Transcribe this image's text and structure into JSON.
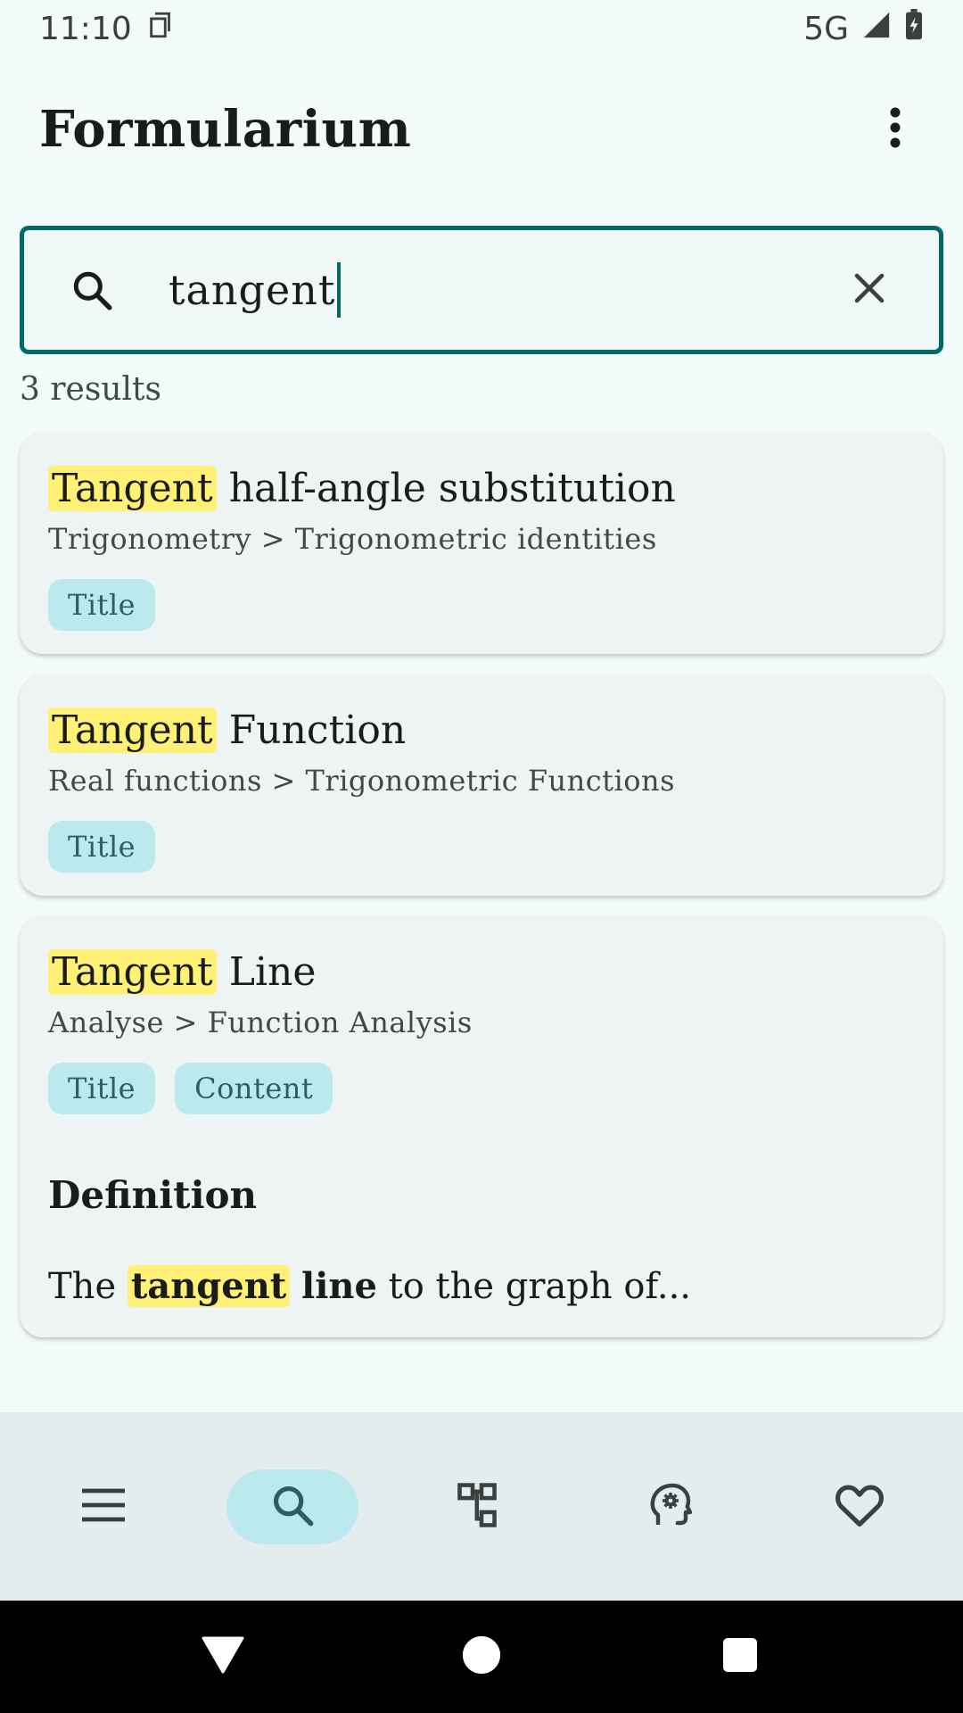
{
  "status_bar": {
    "time": "11:10",
    "network": "5G",
    "icons": [
      "sim-card-icon",
      "signal-icon",
      "battery-charging-icon"
    ]
  },
  "header": {
    "title": "Formularium",
    "menu_icon": "more-vert-icon"
  },
  "search": {
    "value": "tangent",
    "search_icon": "search-icon",
    "clear_icon": "close-icon"
  },
  "results_count": "3 results",
  "results": [
    {
      "highlight": "Tangent",
      "title_rest": " half-angle substitution",
      "path": "Trigonometry > Trigonometric identities",
      "tags": [
        "Title"
      ]
    },
    {
      "highlight": "Tangent",
      "title_rest": " Function",
      "path": "Real functions > Trigonometric Functions",
      "tags": [
        "Title"
      ]
    },
    {
      "highlight": "Tangent",
      "title_rest": " Line",
      "path": "Analyse > Function Analysis",
      "tags": [
        "Title",
        "Content"
      ],
      "section_heading": "Definition",
      "snippet": {
        "before": "The ",
        "highlight": "tangent",
        "space": " ",
        "bold": "line",
        "after": " to the graph of..."
      }
    }
  ],
  "bottom_nav": [
    {
      "icon": "menu-icon",
      "active": false
    },
    {
      "icon": "search-icon",
      "active": true
    },
    {
      "icon": "hierarchy-icon",
      "active": false
    },
    {
      "icon": "brain-gear-icon",
      "active": false
    },
    {
      "icon": "heart-icon",
      "active": false
    }
  ],
  "system_nav": [
    "back-icon",
    "home-icon",
    "recents-icon"
  ],
  "colors": {
    "accent": "#006a6a",
    "highlight": "#fff176",
    "tag_bg": "#bce9ee",
    "background": "#f3fafa"
  }
}
